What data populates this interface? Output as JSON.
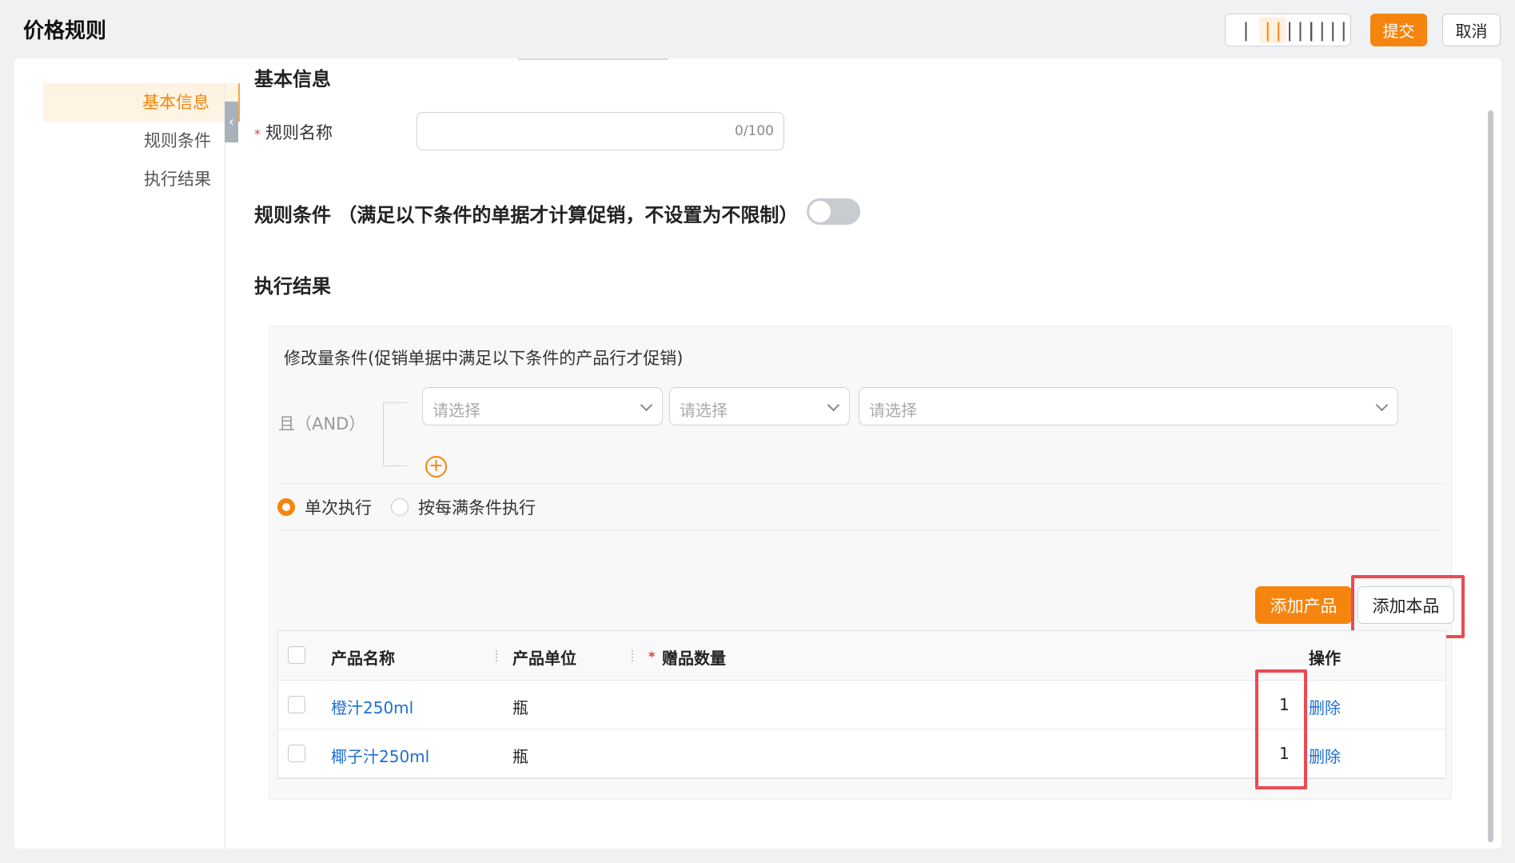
{
  "header": {
    "title": "价格规则",
    "layout_columns": [
      "|",
      "||",
      "|||",
      "||||"
    ],
    "active_layout_index": 1,
    "submit_label": "提交",
    "cancel_label": "取消"
  },
  "anchors": [
    {
      "label": "基本信息",
      "active": true
    },
    {
      "label": "规则条件",
      "active": false
    },
    {
      "label": "执行结果",
      "active": false
    }
  ],
  "basic_info": {
    "title": "基本信息",
    "rule_name_label": "规则名称",
    "rule_name_value": "",
    "rule_name_counter": "0/100",
    "required_mark": "*"
  },
  "rule_conditions": {
    "title": "规则条件  （满足以下条件的单据才计算促销，不设置为不限制）",
    "enabled": false
  },
  "result": {
    "title": "执行结果",
    "condition_title": "修改量条件(促销单据中满足以下条件的产品行才促销)",
    "logic_label": "且（AND）",
    "select_placeholders": [
      "请选择",
      "请选择",
      "请选择"
    ],
    "add_icon": "plus-circle-icon",
    "radio_options": [
      {
        "label": "单次执行",
        "checked": true
      },
      {
        "label": "按每满条件执行",
        "checked": false
      }
    ],
    "add_product_label": "添加产品",
    "add_self_label": "添加本品",
    "table": {
      "headers": {
        "name": "产品名称",
        "unit": "产品单位",
        "qty": "赠品数量",
        "action": "操作"
      },
      "rows": [
        {
          "name": "橙汁250ml",
          "unit": "瓶",
          "qty": "1",
          "action": "删除"
        },
        {
          "name": "椰子汁250ml",
          "unit": "瓶",
          "qty": "1",
          "action": "删除"
        }
      ]
    }
  },
  "colors": {
    "accent": "#f5850f",
    "link": "#1f6fd1",
    "highlight": "#ec4a50"
  }
}
